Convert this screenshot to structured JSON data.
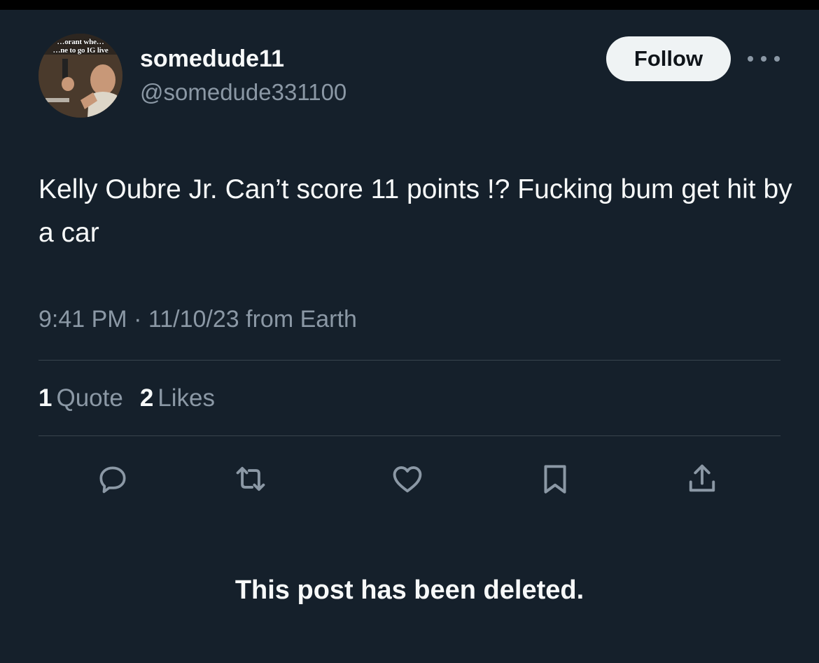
{
  "app": {
    "background": "#15202b",
    "accent_text": "#f7f9f9",
    "secondary_text": "#8b98a5",
    "divider": "#38444d"
  },
  "author": {
    "avatar_caption": "…orant whe…\n…ne to go IG live",
    "display_name": "somedude11",
    "handle": "@somedude331100"
  },
  "header": {
    "follow_label": "Follow",
    "more_icon": "more-horizontal-icon"
  },
  "tweet": {
    "text": "Kelly Oubre Jr. Can’t score 11 points !? Fucking bum get hit by a car",
    "time": "9:41 PM",
    "separator": "·",
    "date": "11/10/23",
    "source": "from Earth"
  },
  "stats": {
    "quotes_count": "1",
    "quotes_label": "Quote",
    "likes_count": "2",
    "likes_label": "Likes"
  },
  "actions": [
    {
      "name": "reply",
      "icon": "reply-icon"
    },
    {
      "name": "repost",
      "icon": "repost-icon"
    },
    {
      "name": "like",
      "icon": "heart-icon"
    },
    {
      "name": "bookmark",
      "icon": "bookmark-icon"
    },
    {
      "name": "share",
      "icon": "share-icon"
    }
  ],
  "notice": "This post has been deleted."
}
